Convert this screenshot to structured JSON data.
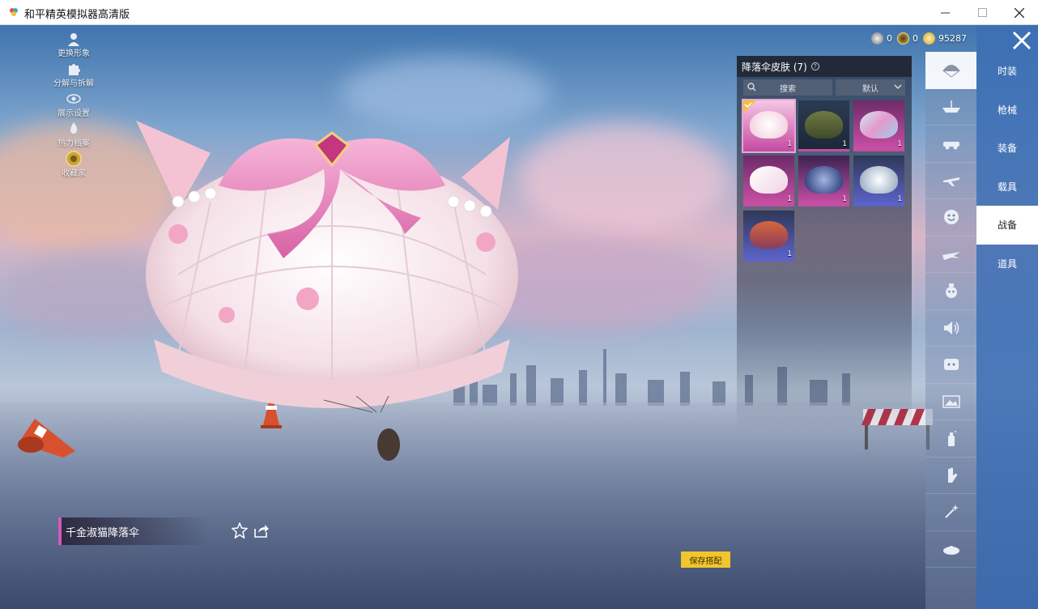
{
  "window": {
    "title": "和平精英模拟器高清版",
    "controls": {
      "minimize": "—",
      "maximize": "☐",
      "close": "✕"
    }
  },
  "side_menu": [
    {
      "label": "更换形象",
      "icon": "person-icon"
    },
    {
      "label": "分解与拆解",
      "icon": "puzzle-icon"
    },
    {
      "label": "展示设置",
      "icon": "eye-icon"
    },
    {
      "label": "热力档案",
      "icon": "fire-icon"
    },
    {
      "label": "收藏家",
      "icon": "collector-badge-icon"
    }
  ],
  "currency": [
    {
      "icon": "silver-coin-icon",
      "value": "0"
    },
    {
      "icon": "token-icon",
      "value": "0"
    },
    {
      "icon": "gold-coin-icon",
      "value": "95287"
    }
  ],
  "panel": {
    "title": "降落伞皮肤 (7)",
    "help": "?",
    "search_label": "搜索",
    "sort_label": "默认",
    "items": [
      {
        "name": "千金淑猫降落伞",
        "qty": "1",
        "rarity": "pink",
        "selected": true
      },
      {
        "name": "green-chute",
        "qty": "1",
        "rarity": "pink",
        "selected": false
      },
      {
        "name": "crystal-chute",
        "qty": "1",
        "rarity": "pink",
        "selected": false
      },
      {
        "name": "white-floral-chute",
        "qty": "1",
        "rarity": "pink",
        "selected": false
      },
      {
        "name": "blue-galaxy-chute",
        "qty": "1",
        "rarity": "pink",
        "selected": false
      },
      {
        "name": "silver-pattern-chute",
        "qty": "1",
        "rarity": "blue",
        "selected": false
      },
      {
        "name": "orange-chute",
        "qty": "1",
        "rarity": "blue",
        "selected": false
      }
    ]
  },
  "categories": [
    {
      "icon": "parachute-icon",
      "active": true
    },
    {
      "icon": "boat-icon",
      "active": false
    },
    {
      "icon": "vehicle-icon",
      "active": false
    },
    {
      "icon": "airplane-icon",
      "active": false
    },
    {
      "icon": "emote-icon",
      "active": false
    },
    {
      "icon": "glider-icon",
      "active": false
    },
    {
      "icon": "pet-icon",
      "active": false
    },
    {
      "icon": "speaker-icon",
      "active": false
    },
    {
      "icon": "badge-icon",
      "active": false
    },
    {
      "icon": "photo-icon",
      "active": false
    },
    {
      "icon": "spray-icon",
      "active": false
    },
    {
      "icon": "gesture-icon",
      "active": false
    },
    {
      "icon": "sparkle-icon",
      "active": false
    },
    {
      "icon": "grenade-icon",
      "active": false
    }
  ],
  "tabs": [
    {
      "label": "时装",
      "active": false
    },
    {
      "label": "枪械",
      "active": false
    },
    {
      "label": "装备",
      "active": false
    },
    {
      "label": "载具",
      "active": false
    },
    {
      "label": "战备",
      "active": true
    },
    {
      "label": "道具",
      "active": false
    }
  ],
  "item_name": "千金淑猫降落伞",
  "save_button": "保存搭配",
  "colors": {
    "accent": "#d15bb8",
    "rarity_blue": "#5c62c8",
    "save": "#f2c52e",
    "tab_rail": "#3c6eb4"
  }
}
